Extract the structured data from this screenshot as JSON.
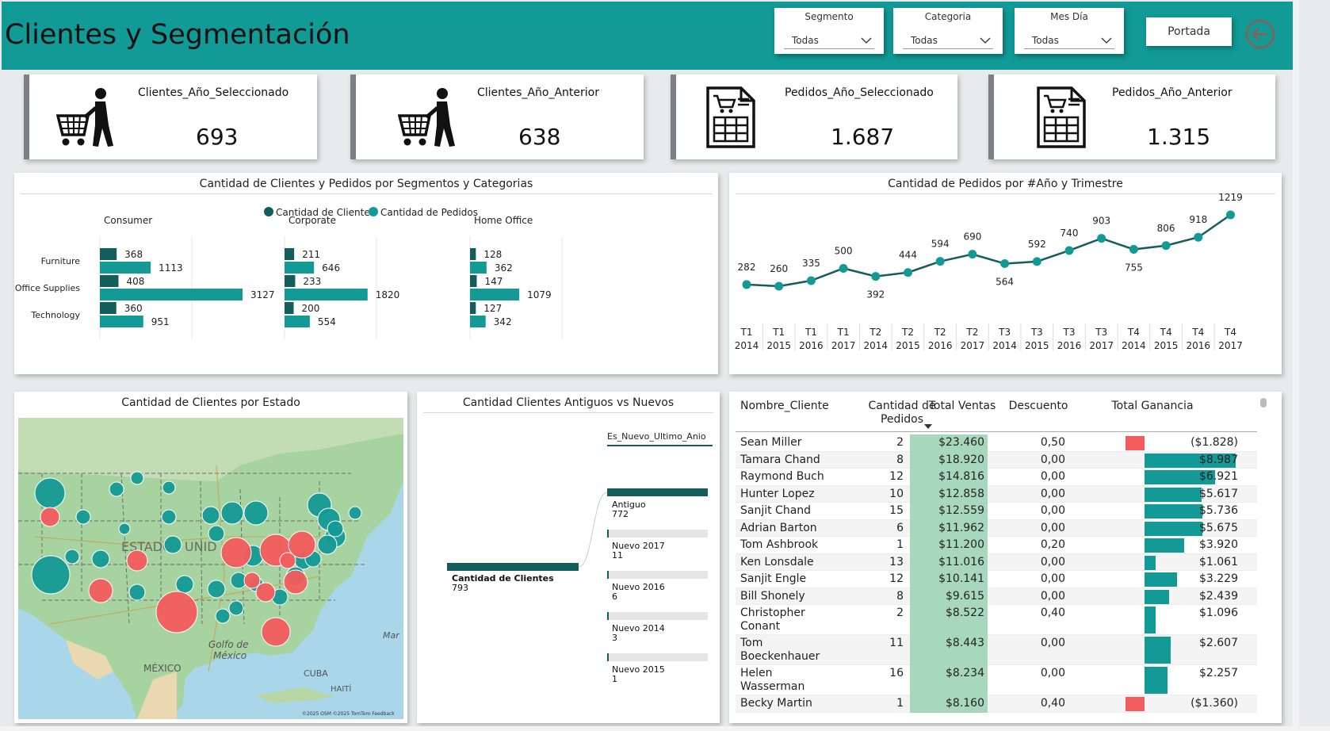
{
  "header": {
    "title": "Clientes y Segmentación",
    "slicers": [
      {
        "label": "Segmento",
        "value": "Todas"
      },
      {
        "label": "Categoria",
        "value": "Todas"
      },
      {
        "label": "Mes Día",
        "value": "Todas"
      }
    ],
    "portada_label": "Portada"
  },
  "kpis": [
    {
      "title": "Clientes_Año_Seleccionado",
      "value": "693",
      "icon": "shopping-cart-person-icon"
    },
    {
      "title": "Clientes_Año_Anterior",
      "value": "638",
      "icon": "shopping-cart-person-icon"
    },
    {
      "title": "Pedidos_Año_Seleccionado",
      "value": "1.687",
      "icon": "order-sheet-icon"
    },
    {
      "title": "Pedidos_Año_Anterior",
      "value": "1.315",
      "icon": "order-sheet-icon"
    }
  ],
  "colors": {
    "dark": "#135e5c",
    "teal": "#139a96",
    "red": "#f25c5c",
    "sales_bg": "#a8d8bc",
    "header": "#119a96"
  },
  "seg_chart": {
    "title": "Cantidad de Clientes y Pedidos por Segmentos y Categorias",
    "legend": [
      "Cantidad de Clientes",
      "Cantidad de Pedidos"
    ],
    "categories": [
      "Furniture",
      "Office Supplies",
      "Technology"
    ],
    "segments": [
      {
        "name": "Consumer",
        "clientes": [
          368,
          408,
          360
        ],
        "pedidos": [
          1113,
          3127,
          951
        ]
      },
      {
        "name": "Corporate",
        "clientes": [
          211,
          233,
          200
        ],
        "pedidos": [
          646,
          1820,
          554
        ]
      },
      {
        "name": "Home Office",
        "clientes": [
          128,
          147,
          127
        ],
        "pedidos": [
          362,
          1079,
          342
        ]
      }
    ]
  },
  "line_chart": {
    "title": "Cantidad de Pedidos por #Año y Trimestre",
    "type": "line",
    "x": [
      "T1 2014",
      "T1 2015",
      "T1 2016",
      "T1 2017",
      "T2 2014",
      "T2 2015",
      "T2 2016",
      "T2 2017",
      "T3 2014",
      "T3 2015",
      "T3 2016",
      "T3 2017",
      "T4 2014",
      "T4 2015",
      "T4 2016",
      "T4 2017"
    ],
    "values": [
      282,
      260,
      335,
      500,
      392,
      444,
      594,
      690,
      564,
      592,
      740,
      903,
      755,
      806,
      918,
      1219
    ]
  },
  "map": {
    "title": "Cantidad de Clientes por Estado",
    "labels": {
      "usa": "ESTADOS UNID",
      "gulf": "Golfo de México",
      "mexico": "MÉXICO",
      "cuba": "CUBA",
      "haiti": "HAITÍ",
      "mar": "Mar",
      "credit": "©2025 OSM ©2025 TomTom Feedback"
    }
  },
  "tree": {
    "title": "Cantidad Clientes Antiguos vs Nuevos",
    "root_label": "Cantidad de Clientes",
    "root_value": "793",
    "level_header": "Es_Nuevo_Ultimo_Anio",
    "nodes": [
      {
        "label": "Antiguo",
        "value": "772",
        "count": 772
      },
      {
        "label": "Nuevo 2017",
        "value": "11",
        "count": 11
      },
      {
        "label": "Nuevo 2016",
        "value": "6",
        "count": 6
      },
      {
        "label": "Nuevo 2014",
        "value": "3",
        "count": 3
      },
      {
        "label": "Nuevo 2015",
        "value": "1",
        "count": 1
      }
    ]
  },
  "table": {
    "headers": {
      "nombre": "Nombre_Cliente",
      "pedidos": "Cantidad de Pedidos",
      "ventas": "Total Ventas",
      "descuento": "Descuento",
      "ganancia": "Total Ganancia"
    },
    "rows": [
      {
        "nombre": "Sean Miller",
        "pedidos": "2",
        "ventas": "$23.460",
        "descuento": "0,50",
        "ganancia": "($1.828)",
        "g": -1828
      },
      {
        "nombre": "Tamara Chand",
        "pedidos": "8",
        "ventas": "$18.920",
        "descuento": "0,00",
        "ganancia": "$8.987",
        "g": 8987
      },
      {
        "nombre": "Raymond Buch",
        "pedidos": "12",
        "ventas": "$14.816",
        "descuento": "0,00",
        "ganancia": "$6.921",
        "g": 6921
      },
      {
        "nombre": "Hunter Lopez",
        "pedidos": "10",
        "ventas": "$12.858",
        "descuento": "0,00",
        "ganancia": "$5.617",
        "g": 5617
      },
      {
        "nombre": "Sanjit Chand",
        "pedidos": "15",
        "ventas": "$12.559",
        "descuento": "0,00",
        "ganancia": "$5.736",
        "g": 5736
      },
      {
        "nombre": "Adrian Barton",
        "pedidos": "6",
        "ventas": "$11.962",
        "descuento": "0,00",
        "ganancia": "$5.675",
        "g": 5675
      },
      {
        "nombre": "Tom Ashbrook",
        "pedidos": "1",
        "ventas": "$11.200",
        "descuento": "0,20",
        "ganancia": "$3.920",
        "g": 3920
      },
      {
        "nombre": "Ken Lonsdale",
        "pedidos": "13",
        "ventas": "$11.016",
        "descuento": "0,00",
        "ganancia": "$1.061",
        "g": 1061
      },
      {
        "nombre": "Sanjit Engle",
        "pedidos": "12",
        "ventas": "$10.141",
        "descuento": "0,00",
        "ganancia": "$3.229",
        "g": 3229
      },
      {
        "nombre": "Bill Shonely",
        "pedidos": "8",
        "ventas": "$9.615",
        "descuento": "0,00",
        "ganancia": "$2.439",
        "g": 2439
      },
      {
        "nombre": "Christopher Conant",
        "pedidos": "2",
        "ventas": "$8.522",
        "descuento": "0,40",
        "ganancia": "$1.096",
        "g": 1096
      },
      {
        "nombre": "Tom Boeckenhauer",
        "pedidos": "11",
        "ventas": "$8.443",
        "descuento": "0,00",
        "ganancia": "$2.607",
        "g": 2607
      },
      {
        "nombre": "Helen Wasserman",
        "pedidos": "16",
        "ventas": "$8.234",
        "descuento": "0,00",
        "ganancia": "$2.257",
        "g": 2257
      },
      {
        "nombre": "Becky Martin",
        "pedidos": "1",
        "ventas": "$8.160",
        "descuento": "0,40",
        "ganancia": "($1.360)",
        "g": -1360
      }
    ]
  }
}
